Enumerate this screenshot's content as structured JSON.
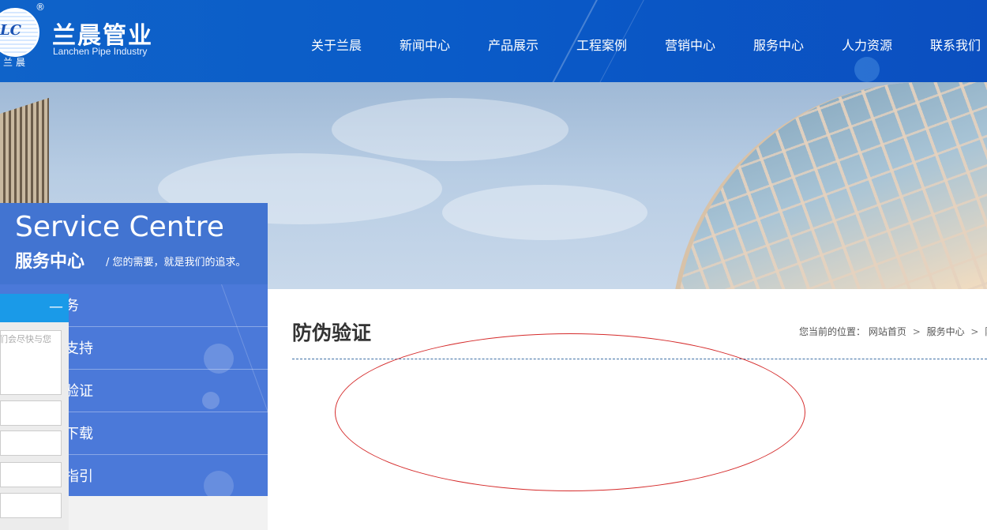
{
  "header": {
    "logo_badge_text": "LC",
    "logo_reg": "®",
    "logo_small": "兰晨",
    "logo_name": "兰晨管业",
    "logo_en": "Lanchen Pipe Industry",
    "nav": [
      "关于兰晨",
      "新闻中心",
      "产品展示",
      "工程案例",
      "营销中心",
      "服务中心",
      "人力资源",
      "联系我们"
    ]
  },
  "sidebar": {
    "title_en": "Service Centre",
    "title_cn": "服务中心",
    "subtitle": "/ 您的需要，就是我们的追求。",
    "items": [
      "务",
      "支持",
      "验证",
      "下载",
      "指引"
    ]
  },
  "message_panel": {
    "minus": "—",
    "textarea_hint": "们会尽快与您"
  },
  "main": {
    "page_title": "防伪验证",
    "breadcrumb": {
      "prefix": "您当前的位置：",
      "home": "网站首页",
      "sep": ">",
      "parent": "服务中心",
      "current": "防伪"
    }
  },
  "colors": {
    "header_blue": "#0a5bc8",
    "sidebar_title_blue": "#4274d1",
    "sidebar_menu_blue": "#4b79d9",
    "panel_head_blue": "#1a9ae8",
    "oval_red": "#d52b2b"
  }
}
